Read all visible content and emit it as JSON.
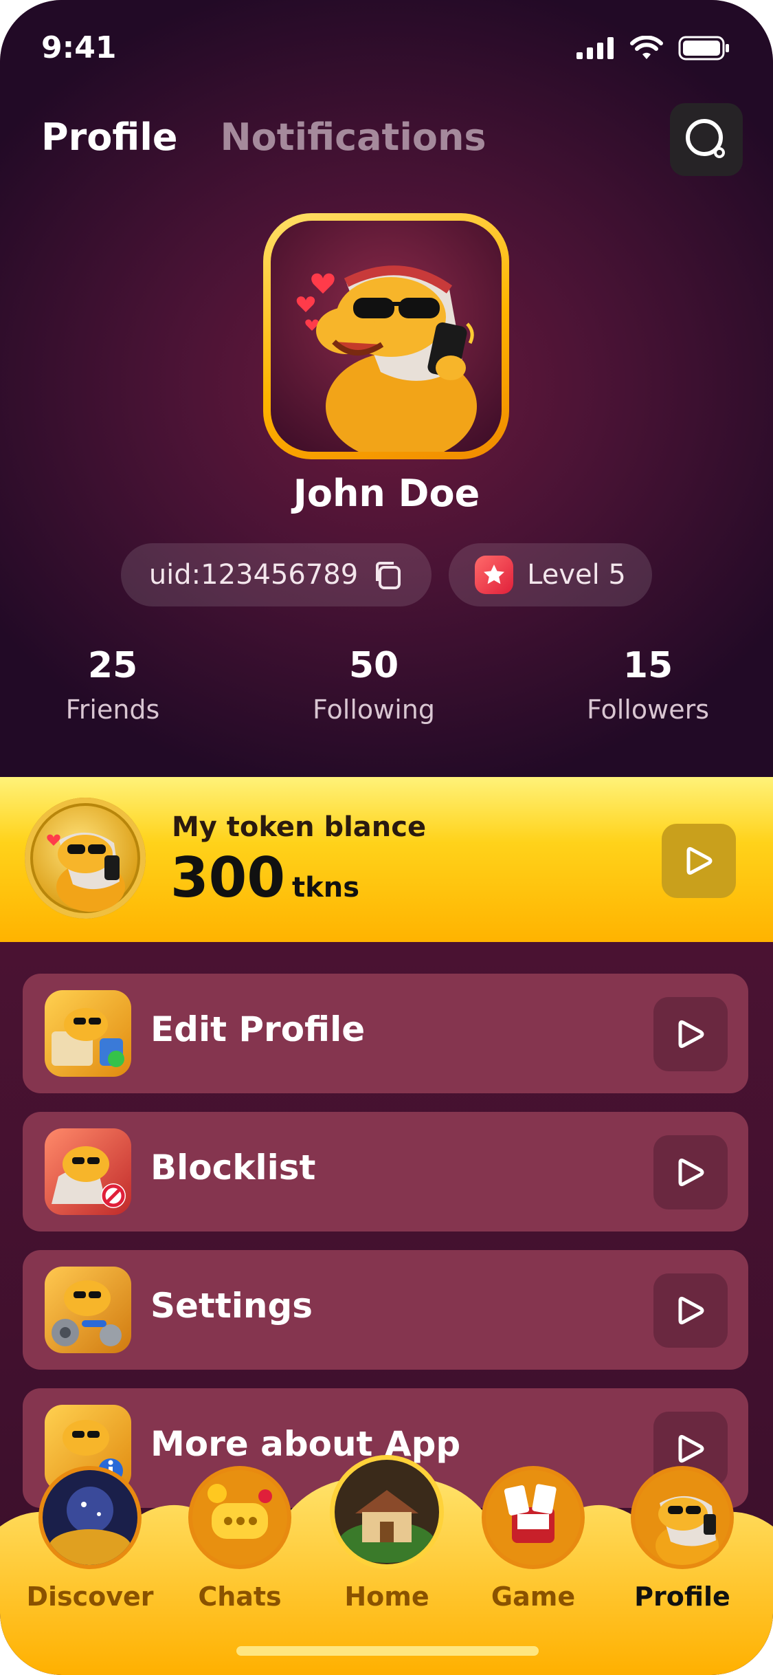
{
  "status_bar": {
    "time": "9:41"
  },
  "tabs": {
    "profile": "Profile",
    "notifications": "Notifications"
  },
  "user": {
    "name": "John Doe",
    "uid": "uid:123456789",
    "level": "Level 5"
  },
  "stats": [
    {
      "value": "25",
      "label": "Friends"
    },
    {
      "value": "50",
      "label": "Following"
    },
    {
      "value": "15",
      "label": "Followers"
    }
  ],
  "token": {
    "label": "My token blance",
    "value": "300",
    "unit": "tkns"
  },
  "menu": [
    {
      "label": "Edit Profile",
      "icon": "edit-profile-icon"
    },
    {
      "label": "Blocklist",
      "icon": "blocklist-icon"
    },
    {
      "label": "Settings",
      "icon": "settings-icon"
    },
    {
      "label": "More about App",
      "icon": "info-icon"
    }
  ],
  "nav": [
    {
      "label": "Discover"
    },
    {
      "label": "Chats"
    },
    {
      "label": "Home"
    },
    {
      "label": "Game"
    },
    {
      "label": "Profile"
    }
  ],
  "colors": {
    "background": "#3a0f2b",
    "accent_gold": "#ffb400",
    "menu_card": "#85354f",
    "tab_inactive": "#a58a9c"
  }
}
